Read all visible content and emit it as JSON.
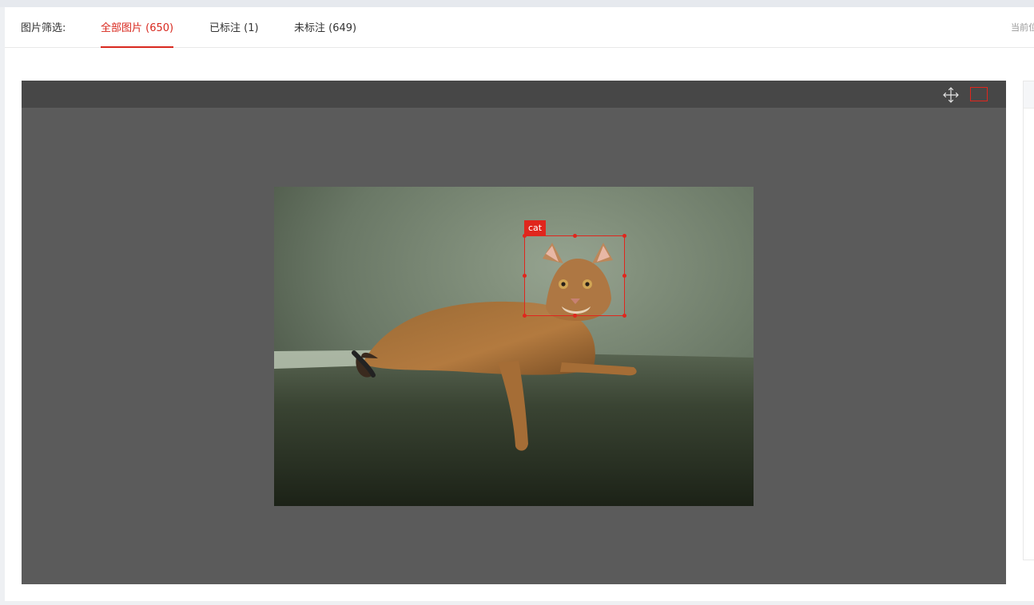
{
  "filter": {
    "label": "图片筛选:",
    "tabs": [
      {
        "label": "全部图片 (650)",
        "active": true
      },
      {
        "label": "已标注 (1)",
        "active": false
      },
      {
        "label": "未标注 (649)",
        "active": false
      }
    ],
    "current_position_label": "当前位"
  },
  "viewer": {
    "tools": [
      "move-icon",
      "rectangle-icon"
    ],
    "annotation": {
      "label": "cat",
      "color": "#e0261d"
    }
  },
  "colors": {
    "accent": "#d8281e",
    "viewer_bg": "#5b5b5b",
    "toolbar_bg": "#474747"
  }
}
